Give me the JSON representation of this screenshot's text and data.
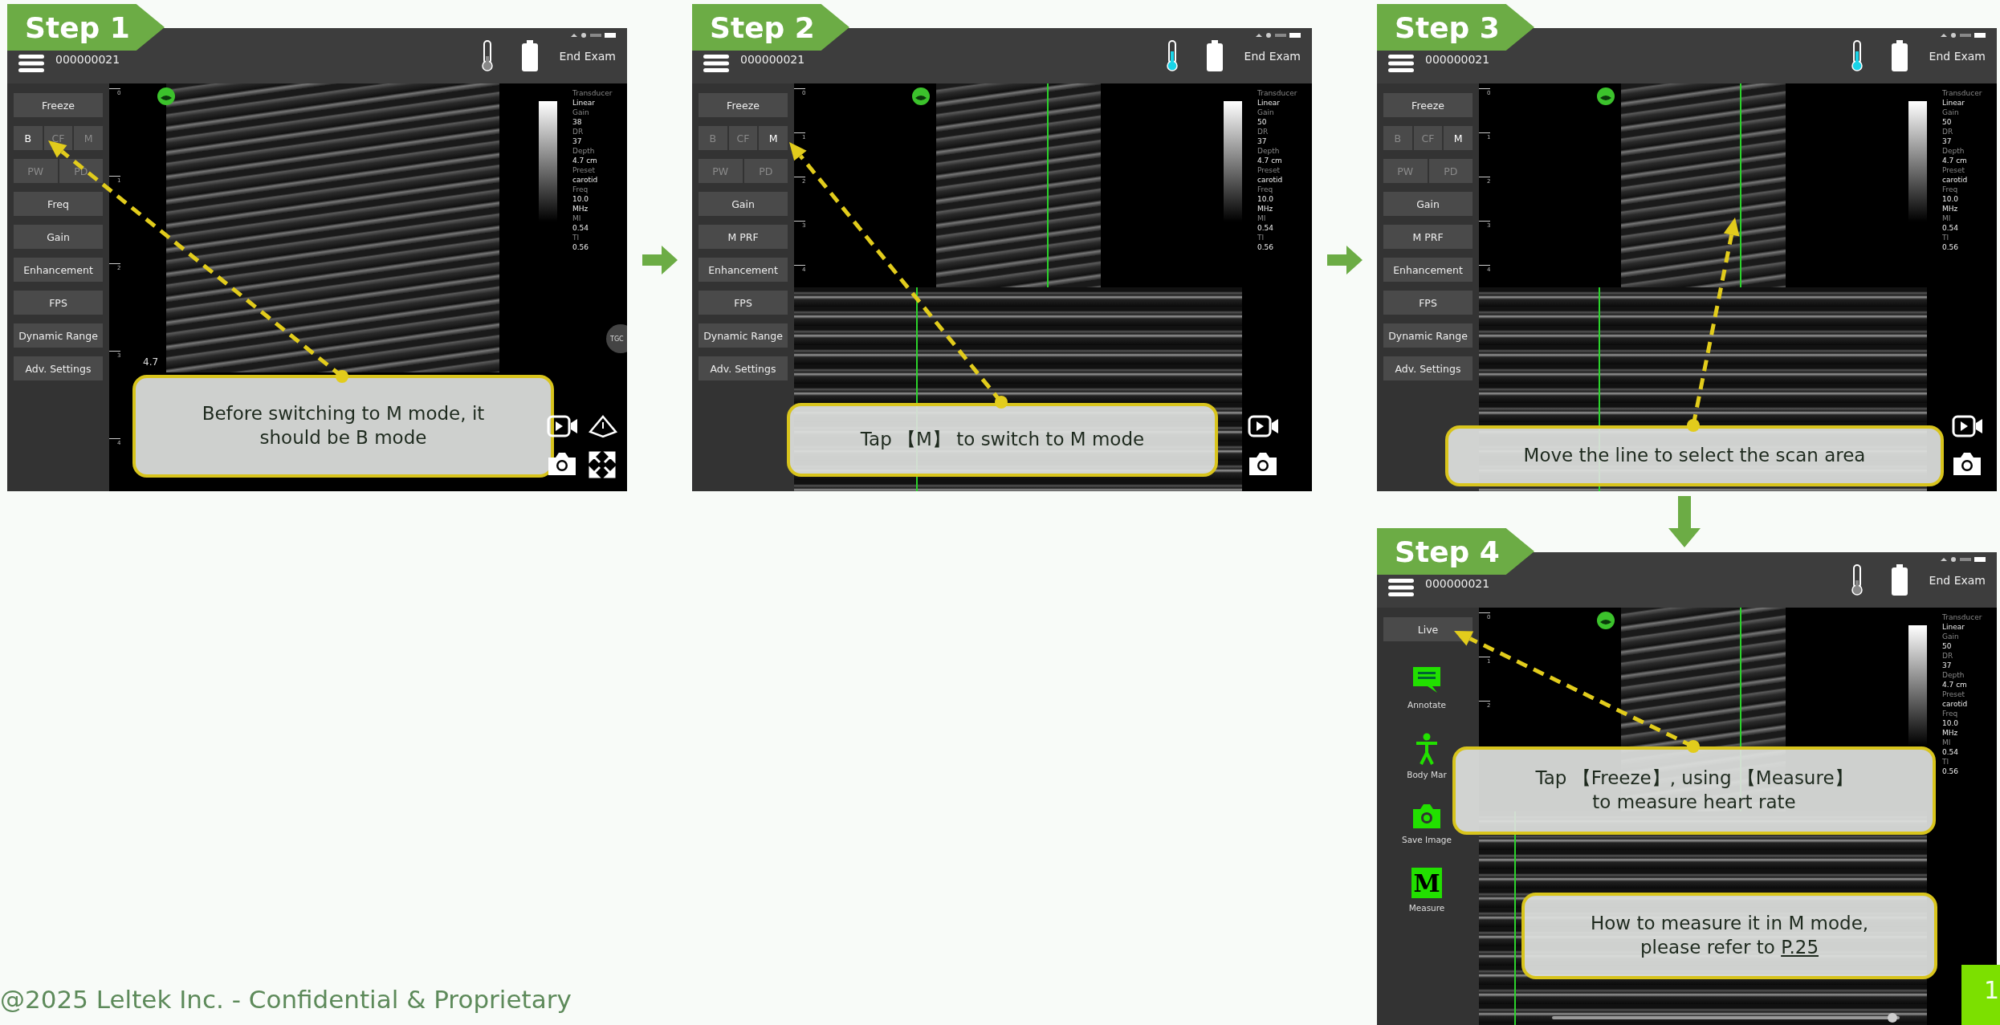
{
  "panels": [
    {
      "step": "Step 1",
      "kind": "b_live",
      "patient_id": "000000021",
      "thermometer_active": false,
      "end_exam": "End Exam",
      "sidebar": [
        {
          "kind": "button",
          "label": "Freeze"
        },
        {
          "kind": "modes",
          "options": [
            {
              "label": "B",
              "selected": true
            },
            {
              "label": "CF",
              "selected": false
            },
            {
              "label": "M",
              "selected": false
            }
          ]
        },
        {
          "kind": "modes",
          "options": [
            {
              "label": "PW",
              "selected": false
            },
            {
              "label": "PD",
              "selected": false
            }
          ]
        },
        {
          "kind": "button",
          "label": "Freq"
        },
        {
          "kind": "button",
          "label": "Gain"
        },
        {
          "kind": "button",
          "label": "Enhancement"
        },
        {
          "kind": "button",
          "label": "FPS"
        },
        {
          "kind": "button",
          "label": "Dynamic Range"
        },
        {
          "kind": "button",
          "label": "Adv. Settings"
        }
      ],
      "depth_marks": [
        "0",
        "1",
        "2",
        "3",
        "4"
      ],
      "params": [
        {
          "label": "Transducer",
          "value": "Linear"
        },
        {
          "label": "Gain",
          "value": "38"
        },
        {
          "label": "DR",
          "value": "37"
        },
        {
          "label": "Depth",
          "value": "4.7 cm"
        },
        {
          "label": "Preset",
          "value": "carotid"
        },
        {
          "label": "Freq",
          "value": "10.0",
          "unit": "MHz"
        },
        {
          "label": "MI",
          "value": "0.54"
        },
        {
          "label": "TI",
          "value": "0.56"
        }
      ],
      "depth_readout": "4.7",
      "tgc": "TGC",
      "callouts": [
        {
          "text": "Before switching to M mode, it\nshould be B mode"
        }
      ]
    },
    {
      "step": "Step 2",
      "kind": "m_live",
      "patient_id": "000000021",
      "thermometer_active": true,
      "end_exam": "End Exam",
      "sidebar": [
        {
          "kind": "button",
          "label": "Freeze"
        },
        {
          "kind": "modes",
          "options": [
            {
              "label": "B",
              "selected": false
            },
            {
              "label": "CF",
              "selected": false
            },
            {
              "label": "M",
              "selected": true
            }
          ]
        },
        {
          "kind": "modes",
          "options": [
            {
              "label": "PW",
              "selected": false
            },
            {
              "label": "PD",
              "selected": false
            }
          ]
        },
        {
          "kind": "button",
          "label": "Gain"
        },
        {
          "kind": "button",
          "label": "M PRF"
        },
        {
          "kind": "button",
          "label": "Enhancement"
        },
        {
          "kind": "button",
          "label": "FPS"
        },
        {
          "kind": "button",
          "label": "Dynamic Range"
        },
        {
          "kind": "button",
          "label": "Adv. Settings"
        }
      ],
      "depth_marks": [
        "0",
        "1",
        "2",
        "3",
        "4"
      ],
      "params": [
        {
          "label": "Transducer",
          "value": "Linear"
        },
        {
          "label": "Gain",
          "value": "50"
        },
        {
          "label": "DR",
          "value": "37"
        },
        {
          "label": "Depth",
          "value": "4.7 cm"
        },
        {
          "label": "Preset",
          "value": "carotid"
        },
        {
          "label": "Freq",
          "value": "10.0",
          "unit": "MHz"
        },
        {
          "label": "MI",
          "value": "0.54"
        },
        {
          "label": "TI",
          "value": "0.56"
        }
      ],
      "callouts": [
        {
          "text": "Tap 【M】 to switch to M mode"
        }
      ]
    },
    {
      "step": "Step 3",
      "kind": "m_live",
      "patient_id": "000000021",
      "thermometer_active": true,
      "end_exam": "End Exam",
      "sidebar": [
        {
          "kind": "button",
          "label": "Freeze"
        },
        {
          "kind": "modes",
          "options": [
            {
              "label": "B",
              "selected": false
            },
            {
              "label": "CF",
              "selected": false
            },
            {
              "label": "M",
              "selected": true
            }
          ]
        },
        {
          "kind": "modes",
          "options": [
            {
              "label": "PW",
              "selected": false
            },
            {
              "label": "PD",
              "selected": false
            }
          ]
        },
        {
          "kind": "button",
          "label": "Gain"
        },
        {
          "kind": "button",
          "label": "M PRF"
        },
        {
          "kind": "button",
          "label": "Enhancement"
        },
        {
          "kind": "button",
          "label": "FPS"
        },
        {
          "kind": "button",
          "label": "Dynamic Range"
        },
        {
          "kind": "button",
          "label": "Adv. Settings"
        }
      ],
      "depth_marks": [
        "0",
        "1",
        "2",
        "3",
        "4"
      ],
      "params": [
        {
          "label": "Transducer",
          "value": "Linear"
        },
        {
          "label": "Gain",
          "value": "50"
        },
        {
          "label": "DR",
          "value": "37"
        },
        {
          "label": "Depth",
          "value": "4.7 cm"
        },
        {
          "label": "Preset",
          "value": "carotid"
        },
        {
          "label": "Freq",
          "value": "10.0",
          "unit": "MHz"
        },
        {
          "label": "MI",
          "value": "0.54"
        },
        {
          "label": "TI",
          "value": "0.56"
        }
      ],
      "callouts": [
        {
          "text": "Move the line to select the scan area"
        }
      ]
    },
    {
      "step": "Step 4",
      "kind": "m_frozen",
      "patient_id": "000000021",
      "thermometer_active": false,
      "end_exam": "End Exam",
      "sidebar": [
        {
          "kind": "button",
          "label": "Live"
        },
        {
          "kind": "tool",
          "label": "Annotate"
        },
        {
          "kind": "tool",
          "label": "Body Mar"
        },
        {
          "kind": "tool",
          "label": "Save Image"
        },
        {
          "kind": "tool",
          "label": "Measure",
          "glyph": "M"
        }
      ],
      "depth_marks": [
        "0",
        "1",
        "2"
      ],
      "params": [
        {
          "label": "Transducer",
          "value": "Linear"
        },
        {
          "label": "Gain",
          "value": "50"
        },
        {
          "label": "DR",
          "value": "37"
        },
        {
          "label": "Depth",
          "value": "4.7 cm"
        },
        {
          "label": "Preset",
          "value": "carotid"
        },
        {
          "label": "Freq",
          "value": "10.0",
          "unit": "MHz"
        },
        {
          "label": "MI",
          "value": "0.54"
        },
        {
          "label": "TI",
          "value": "0.56"
        }
      ],
      "cine": {
        "level": 0.98
      },
      "callouts": [
        {
          "text": "Tap 【Freeze】, using 【Measure】\nto measure heart rate"
        },
        {
          "text": "How to measure it in M mode,\nplease refer to",
          "link": "P.25"
        }
      ]
    }
  ],
  "footer": "@2025 Leltek Inc. - Confidential & Proprietary",
  "page_number": "1"
}
